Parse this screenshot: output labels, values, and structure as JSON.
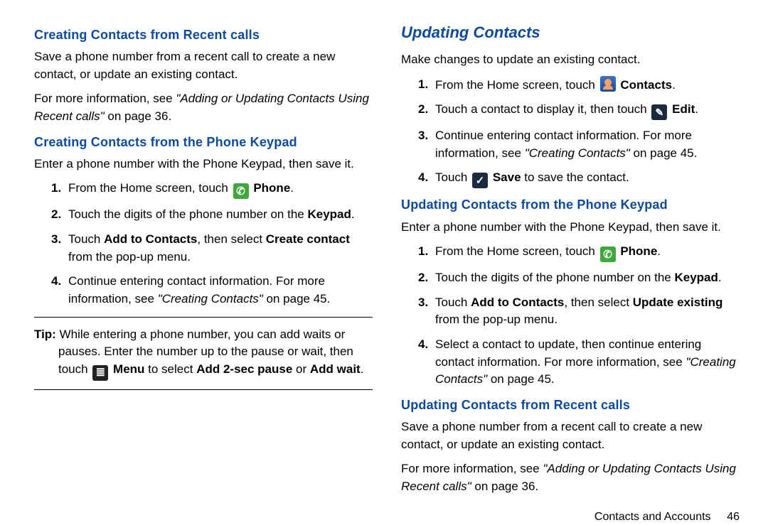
{
  "left": {
    "s1": {
      "title": "Creating Contacts from Recent calls",
      "p1": "Save a phone number from a recent call to create a new contact, or update an existing contact.",
      "p2a": "For more information, see ",
      "p2b": "\"Adding or Updating Contacts Using Recent calls\"",
      "p2c": " on page 36."
    },
    "s2": {
      "title": "Creating Contacts from the Phone Keypad",
      "p1": "Enter a phone number with the Phone Keypad, then save it.",
      "li1a": "From the Home screen, touch ",
      "li1b": "Phone",
      "li1c": ".",
      "li2a": "Touch the digits of the phone number on the ",
      "li2b": "Keypad",
      "li2c": ".",
      "li3a": "Touch ",
      "li3b": "Add to Contacts",
      "li3c": ", then select ",
      "li3d": "Create contact",
      "li3e": " from the pop-up menu.",
      "li4a": "Continue entering contact information. For more information, see ",
      "li4b": "\"Creating Contacts\"",
      "li4c": " on page 45."
    },
    "tip": {
      "label": "Tip:",
      "l1": "While entering a phone number, you can add waits or",
      "l2": "pauses. Enter the number up to the pause or wait, then",
      "l3a": "touch ",
      "l3b": "Menu",
      "l3c": " to select ",
      "l3d": "Add 2-sec pause",
      "l3e": " or ",
      "l3f": "Add wait",
      "l3g": "."
    }
  },
  "right": {
    "h1": "Updating Contacts",
    "p1": "Make changes to update an existing contact.",
    "li1a": "From the Home screen, touch ",
    "li1b": "Contacts",
    "li1c": ".",
    "li2a": "Touch a contact to display it, then touch ",
    "li2b": "Edit",
    "li2c": ".",
    "li3a": "Continue entering contact information. For more information, see ",
    "li3b": "\"Creating Contacts\"",
    "li3c": " on page 45.",
    "li4a": "Touch ",
    "li4b": "Save",
    "li4c": " to save the contact.",
    "s1": {
      "title": "Updating Contacts from the Phone Keypad",
      "p1": "Enter a phone number with the Phone Keypad, then save it.",
      "li1a": "From the Home screen, touch ",
      "li1b": "Phone",
      "li1c": ".",
      "li2a": "Touch the digits of the phone number on the ",
      "li2b": "Keypad",
      "li2c": ".",
      "li3a": "Touch ",
      "li3b": "Add to Contacts",
      "li3c": ", then select ",
      "li3d": "Update existing",
      "li3e": " from the pop-up menu.",
      "li4a": "Select a contact to update, then continue entering contact information. For more information, see ",
      "li4b": "\"Creating Contacts\"",
      "li4c": " on page 45."
    },
    "s2": {
      "title": "Updating Contacts from Recent calls",
      "p1": "Save a phone number from a recent call to create a new contact, or update an existing contact.",
      "p2a": "For more information, see ",
      "p2b": "\"Adding or Updating Contacts Using Recent calls\"",
      "p2c": " on page 36."
    },
    "footer": {
      "section": "Contacts and Accounts",
      "page": "46"
    }
  },
  "nums": {
    "n1": "1.",
    "n2": "2.",
    "n3": "3.",
    "n4": "4."
  }
}
